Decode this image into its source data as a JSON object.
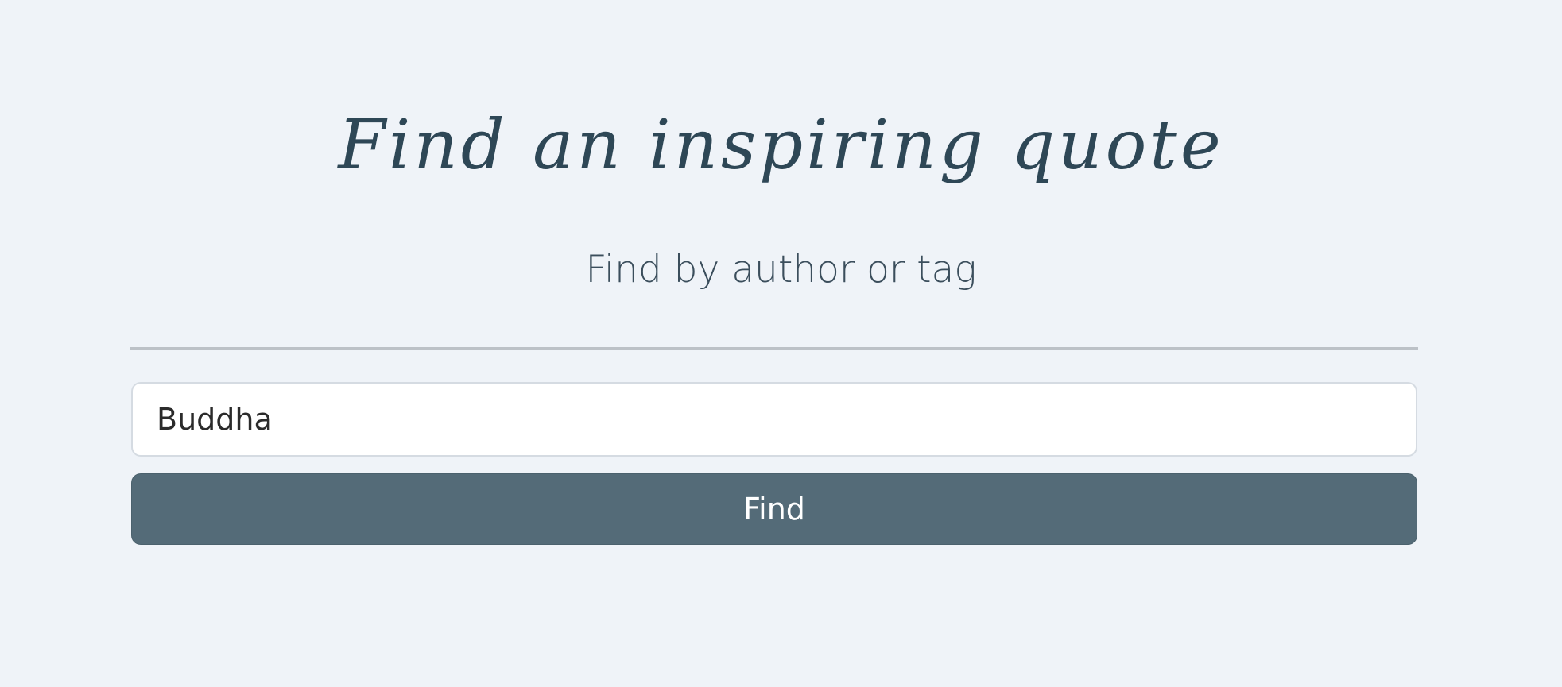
{
  "header": {
    "title": "Find an inspiring quote",
    "subtitle": "Find by author or tag"
  },
  "search": {
    "value": "Buddha",
    "placeholder": ""
  },
  "actions": {
    "find_label": "Find"
  },
  "colors": {
    "background": "#eff3f8",
    "title": "#2e4756",
    "button": "#546b78",
    "divider": "#bcc1c7"
  }
}
